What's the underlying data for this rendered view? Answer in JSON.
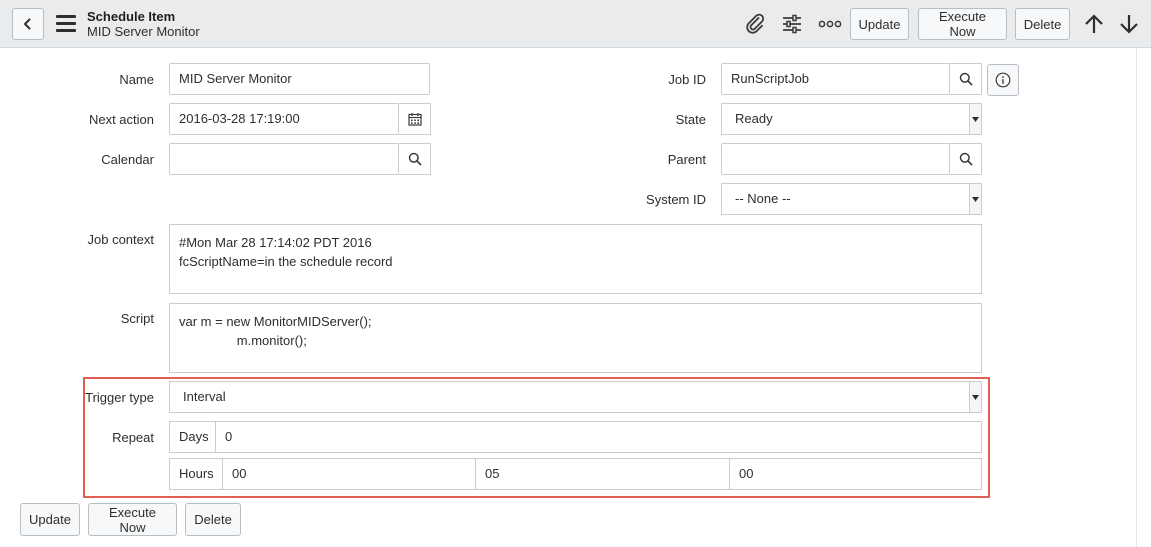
{
  "header": {
    "title": "Schedule Item",
    "subtitle": "MID Server Monitor",
    "buttons": {
      "update": "Update",
      "execute_now": "Execute Now",
      "delete": "Delete"
    },
    "icons": [
      "chevron-left-icon",
      "hamburger-icon",
      "paperclip-icon",
      "sliders-icon",
      "more-icon",
      "arrow-up-icon",
      "arrow-down-icon"
    ]
  },
  "form": {
    "name": {
      "label": "Name",
      "value": "MID Server Monitor"
    },
    "next_action": {
      "label": "Next action",
      "value": "2016-03-28 17:19:00"
    },
    "calendar": {
      "label": "Calendar",
      "value": ""
    },
    "job_id": {
      "label": "Job ID",
      "value": "RunScriptJob"
    },
    "state": {
      "label": "State",
      "value": "Ready"
    },
    "parent": {
      "label": "Parent",
      "value": ""
    },
    "system_id": {
      "label": "System ID",
      "value": "-- None --"
    },
    "job_context": {
      "label": "Job context",
      "value": "#Mon Mar 28 17:14:02 PDT 2016\nfcScriptName=in the schedule record"
    },
    "script": {
      "label": "Script",
      "value": "var m = new MonitorMIDServer();\n                m.monitor();"
    },
    "trigger_type": {
      "label": "Trigger type",
      "value": "Interval"
    },
    "repeat": {
      "label": "Repeat",
      "days_label": "Days",
      "days": "0",
      "hours_label": "Hours",
      "hours": "00",
      "minutes": "05",
      "seconds": "00"
    }
  },
  "footer": {
    "update": "Update",
    "execute_now": "Execute Now",
    "delete": "Delete"
  },
  "colors": {
    "highlight": "#e06055",
    "header_bg": "#e9ebed"
  }
}
